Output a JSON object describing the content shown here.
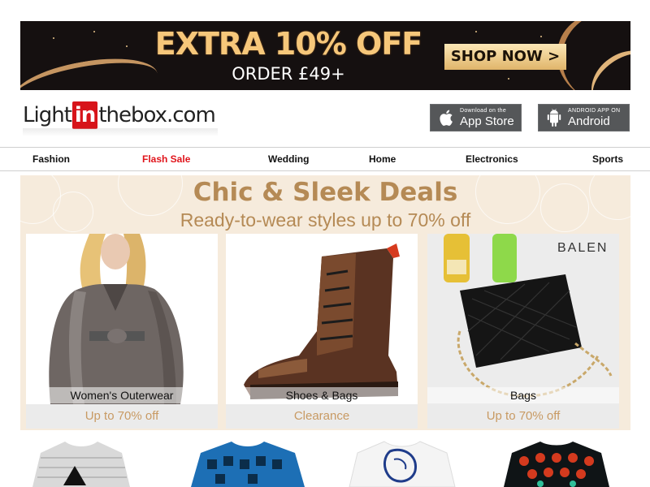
{
  "banner": {
    "headline": "EXTRA 10% OFF",
    "subline": "ORDER £49+",
    "cta": "SHOP NOW >",
    "colors": {
      "background": "#151010",
      "gold": "#f6c77a"
    }
  },
  "header": {
    "logo": {
      "pre": "Light",
      "in": "in",
      "post": "thebox.com"
    },
    "app_store": {
      "small": "Download on the",
      "big": "App Store",
      "icon": "apple-icon"
    },
    "android": {
      "small": "ANDROID APP ON",
      "big": "Android",
      "icon": "android-icon"
    }
  },
  "nav": {
    "items": [
      {
        "label": "Fashion"
      },
      {
        "label": "Flash Sale",
        "highlight": "#e0141b"
      },
      {
        "label": "Wedding"
      },
      {
        "label": "Home"
      },
      {
        "label": "Electronics"
      },
      {
        "label": "Sports"
      }
    ]
  },
  "promo": {
    "title": "Chic & Sleek Deals",
    "subtitle": "Ready-to-wear styles up to 70% off",
    "colors": {
      "background": "#f6ebdc",
      "text": "#b58a55"
    },
    "cards": [
      {
        "label": "Women's Outerwear",
        "offer": "Up to 70% off"
      },
      {
        "label": "Shoes & Bags",
        "offer": "Clearance"
      },
      {
        "label": "Bags",
        "offer": "Up to 70% off",
        "brand_text": "BALEN"
      }
    ]
  }
}
